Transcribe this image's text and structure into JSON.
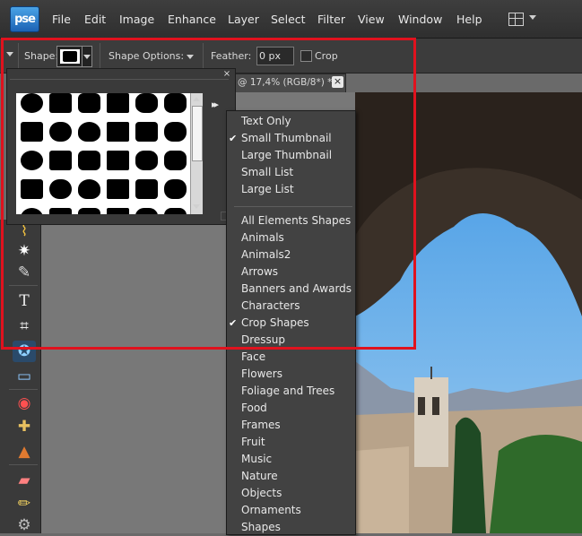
{
  "app": {
    "logo_text": "pse"
  },
  "menu": [
    "File",
    "Edit",
    "Image",
    "Enhance",
    "Layer",
    "Select",
    "Filter",
    "View",
    "Window",
    "Help"
  ],
  "options_bar": {
    "shape_label": "Shape:",
    "shape_options_label": "Shape Options:",
    "feather_label": "Feather:",
    "feather_value": "0 px",
    "crop_label": "Crop"
  },
  "document_tab": {
    "title": "g @ 17,4% (RGB/8*) *",
    "close_glyph": "×"
  },
  "shape_panel": {
    "close_glyph": "×",
    "flyout_glyph": "▸▸"
  },
  "dropdown": {
    "view_options": [
      {
        "label": "Text Only",
        "checked": false
      },
      {
        "label": "Small Thumbnail",
        "checked": true
      },
      {
        "label": "Large Thumbnail",
        "checked": false
      },
      {
        "label": "Small List",
        "checked": false
      },
      {
        "label": "Large List",
        "checked": false
      }
    ],
    "categories": [
      {
        "label": "All Elements Shapes",
        "checked": false
      },
      {
        "label": "Animals",
        "checked": false
      },
      {
        "label": "Animals2",
        "checked": false
      },
      {
        "label": "Arrows",
        "checked": false
      },
      {
        "label": "Banners and Awards",
        "checked": false
      },
      {
        "label": "Characters",
        "checked": false
      },
      {
        "label": "Crop Shapes",
        "checked": true
      },
      {
        "label": "Dressup",
        "checked": false
      },
      {
        "label": "Face",
        "checked": false
      },
      {
        "label": "Flowers",
        "checked": false
      },
      {
        "label": "Foliage and Trees",
        "checked": false
      },
      {
        "label": "Food",
        "checked": false
      },
      {
        "label": "Frames",
        "checked": false
      },
      {
        "label": "Fruit",
        "checked": false
      },
      {
        "label": "Music",
        "checked": false
      },
      {
        "label": "Nature",
        "checked": false
      },
      {
        "label": "Objects",
        "checked": false
      },
      {
        "label": "Ornaments",
        "checked": false
      },
      {
        "label": "Shapes",
        "checked": false
      }
    ]
  },
  "colors": {
    "highlight": "#e0121e",
    "sky": "#5aa8e8",
    "rock": "#3a3028"
  }
}
